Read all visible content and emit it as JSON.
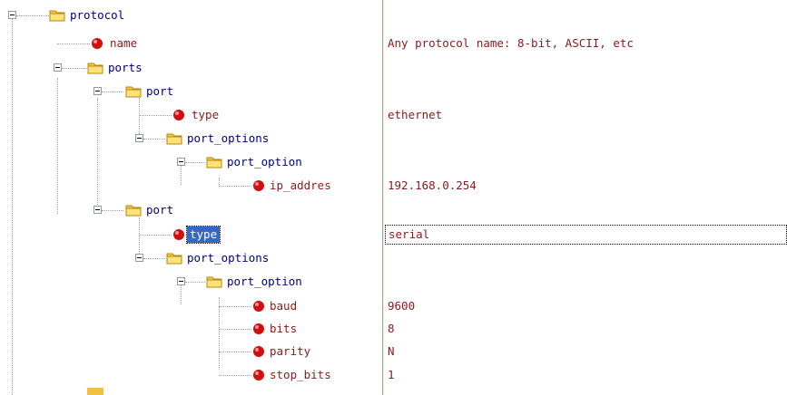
{
  "tree": {
    "nodes": [
      {
        "label": "protocol",
        "kind": "folder",
        "value": ""
      },
      {
        "label": "name",
        "kind": "attr",
        "value": "Any protocol name: 8-bit, ASCII, etc"
      },
      {
        "label": "ports",
        "kind": "folder",
        "value": ""
      },
      {
        "label": "port",
        "kind": "folder",
        "value": ""
      },
      {
        "label": "type",
        "kind": "attr",
        "value": "ethernet"
      },
      {
        "label": "port_options",
        "kind": "folder",
        "value": ""
      },
      {
        "label": "port_option",
        "kind": "folder",
        "value": ""
      },
      {
        "label": "ip_addres",
        "kind": "attr",
        "value": "192.168.0.254"
      },
      {
        "label": "port",
        "kind": "folder",
        "value": ""
      },
      {
        "label": "type",
        "kind": "attr",
        "value": "serial",
        "selected": true
      },
      {
        "label": "port_options",
        "kind": "folder",
        "value": ""
      },
      {
        "label": "port_option",
        "kind": "folder",
        "value": ""
      },
      {
        "label": "baud",
        "kind": "attr",
        "value": "9600"
      },
      {
        "label": "bits",
        "kind": "attr",
        "value": "8"
      },
      {
        "label": "parity",
        "kind": "attr",
        "value": "N"
      },
      {
        "label": "stop_bits",
        "kind": "attr",
        "value": "1"
      }
    ]
  },
  "icons": {
    "folder": "folder-icon",
    "attribute": "attribute-bullet-icon",
    "expander": "collapse-icon"
  },
  "colors": {
    "folder_label": "#000080",
    "attr_label": "#8b1a1a",
    "selection": "#316ac5"
  }
}
